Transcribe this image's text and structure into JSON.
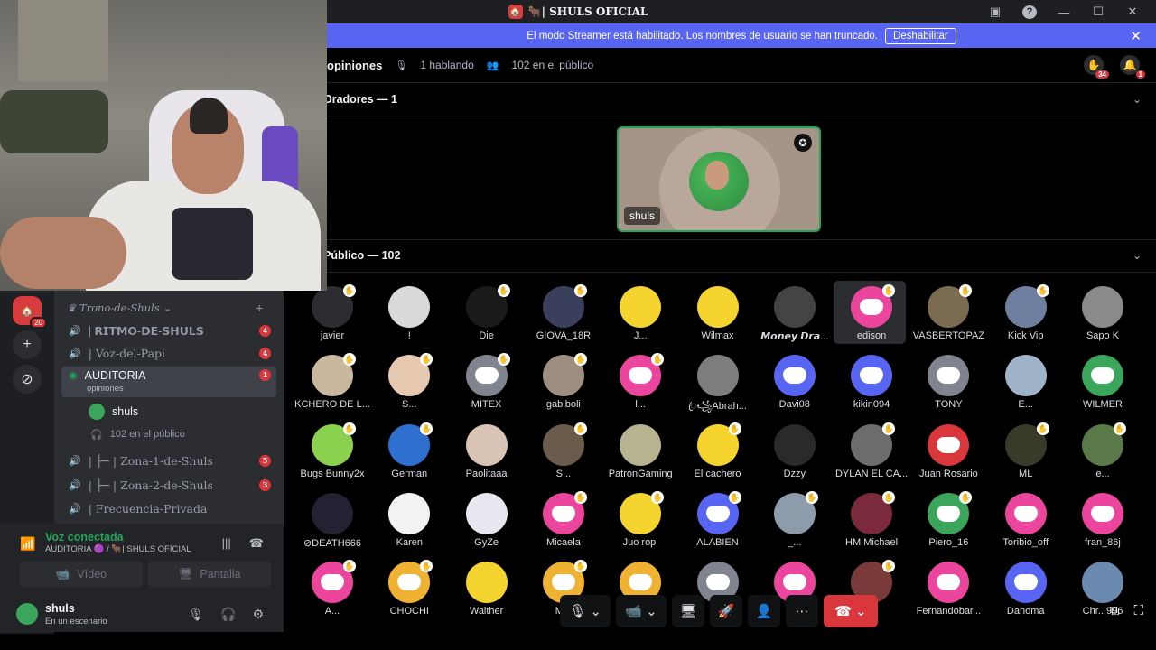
{
  "window": {
    "title": "🐂| SHULS OFICIAL"
  },
  "banner": {
    "text": "El modo Streamer está habilitado. Los nombres de usuario se han truncado.",
    "button": "Deshabilitar"
  },
  "stage_header": {
    "channel": "opiniones",
    "speaking": "1 hablando",
    "audience": "102 en el público",
    "hand_count": "34",
    "notif_count": "1"
  },
  "sections": {
    "speakers": "Oradores — 1",
    "audience": "Público — 102"
  },
  "speaker": {
    "name": "shuls"
  },
  "audience": [
    {
      "name": "javier",
      "color": "#2b2d31",
      "hand": true
    },
    {
      "name": "!",
      "color": "#d9d9d9",
      "hand": false
    },
    {
      "name": "Die",
      "color": "#1a1a1a",
      "hand": true
    },
    {
      "name": "GIOVA_18R",
      "color": "#3a3f5c",
      "hand": true
    },
    {
      "name": "J...",
      "color": "#f6d42f",
      "hand": false
    },
    {
      "name": "Wilmax",
      "color": "#f6d42f",
      "hand": false
    },
    {
      "name": "𝙈𝙤𝙣𝙚𝙮 𝘿𝙧𝙖...",
      "color": "#444444",
      "hand": false
    },
    {
      "name": "edison",
      "color": "#eb459e",
      "hand": true,
      "discord": true,
      "highlight": true
    },
    {
      "name": "VASBERTOPAZ",
      "color": "#7a6a50",
      "hand": true
    },
    {
      "name": "Kick Vip",
      "color": "#6f7f9f",
      "hand": true
    },
    {
      "name": "Sapo K",
      "color": "#8a8a8a",
      "hand": false
    },
    {
      "name": "KCHERO DE L...",
      "color": "#c9b7a0",
      "hand": true
    },
    {
      "name": "S...",
      "color": "#e7c8b0",
      "hand": true
    },
    {
      "name": "MITEX",
      "color": "#80848e",
      "hand": true,
      "discord": true
    },
    {
      "name": "gabiboli",
      "color": "#9c8f80",
      "hand": true
    },
    {
      "name": "l...",
      "color": "#eb459e",
      "hand": true,
      "discord": true
    },
    {
      "name": "ꦿ꧁Abrah...",
      "color": "#7d7d7d",
      "hand": false
    },
    {
      "name": "Davi08",
      "color": "#5865f2",
      "hand": false,
      "discord": true
    },
    {
      "name": "kikin094",
      "color": "#5865f2",
      "hand": false,
      "discord": true
    },
    {
      "name": "TONY",
      "color": "#80848e",
      "hand": false,
      "discord": true
    },
    {
      "name": "E...",
      "color": "#9fb3c8",
      "hand": false
    },
    {
      "name": "WILMER",
      "color": "#3ba55c",
      "hand": false,
      "discord": true
    },
    {
      "name": "Bugs Bunny2x",
      "color": "#8ad14f",
      "hand": true
    },
    {
      "name": "German",
      "color": "#2e6fd0",
      "hand": true
    },
    {
      "name": "Paolitaaa",
      "color": "#d8c3b4",
      "hand": false
    },
    {
      "name": "S...",
      "color": "#6b5b4b",
      "hand": true
    },
    {
      "name": "PatronGaming",
      "color": "#b7b28f",
      "hand": false
    },
    {
      "name": "El cachero",
      "color": "#f6d42f",
      "hand": true
    },
    {
      "name": "Dzzy",
      "color": "#2a2a2a",
      "hand": false
    },
    {
      "name": "DYLAN EL CA...",
      "color": "#6d6d6d",
      "hand": true
    },
    {
      "name": "Juan Rosario",
      "color": "#da373c",
      "hand": false,
      "discord": true
    },
    {
      "name": "ML",
      "color": "#3a3a2a",
      "hand": true
    },
    {
      "name": "e...",
      "color": "#5b7a4a",
      "hand": true
    },
    {
      "name": "⊘DEATH666",
      "color": "#222233",
      "hand": false
    },
    {
      "name": "Karen",
      "color": "#f2f2f2",
      "hand": false
    },
    {
      "name": "GyZe",
      "color": "#e7e7ef",
      "hand": false
    },
    {
      "name": "Micaela",
      "color": "#eb459e",
      "hand": true,
      "discord": true
    },
    {
      "name": "Juo ropl",
      "color": "#f6d42f",
      "hand": true
    },
    {
      "name": "ALABIEN",
      "color": "#5865f2",
      "hand": true,
      "discord": true
    },
    {
      "name": "_...",
      "color": "#8d9caa",
      "hand": true
    },
    {
      "name": "HM Michael",
      "color": "#7a2a3a",
      "hand": true
    },
    {
      "name": "Piero_16",
      "color": "#3ba55c",
      "hand": true,
      "discord": true
    },
    {
      "name": "Toribio_off",
      "color": "#eb459e",
      "hand": false,
      "discord": true
    },
    {
      "name": "fran_86j",
      "color": "#eb459e",
      "hand": false,
      "discord": true
    },
    {
      "name": "A...",
      "color": "#eb459e",
      "hand": true,
      "discord": true
    },
    {
      "name": "CHOCHI",
      "color": "#f0b232",
      "hand": true,
      "discord": true
    },
    {
      "name": "Walther",
      "color": "#f6d42f",
      "hand": false
    },
    {
      "name": "M...",
      "color": "#f0b232",
      "hand": true,
      "discord": true
    },
    {
      "name": "",
      "color": "#f0b232",
      "hand": false,
      "discord": true
    },
    {
      "name": "",
      "color": "#80848e",
      "hand": false,
      "discord": true
    },
    {
      "name": "",
      "color": "#eb459e",
      "hand": false,
      "discord": true
    },
    {
      "name": "",
      "color": "#7a3a3a",
      "hand": true
    },
    {
      "name": "Fernandobar...",
      "color": "#eb459e",
      "hand": false,
      "discord": true
    },
    {
      "name": "Danoma",
      "color": "#5865f2",
      "hand": false,
      "discord": true
    },
    {
      "name": "Chr...996",
      "color": "#6a8ab0",
      "hand": false
    }
  ],
  "sidebar": {
    "server_badge": "20",
    "category": "Trono-de-Shuls",
    "channels": [
      {
        "name": "| 𝗥𝗜𝗧𝗠𝗢-𝗗𝗘-𝗦𝗛𝗨𝗟𝗦",
        "badge": "4"
      },
      {
        "name": "| Voz-del-Papi",
        "badge": "4"
      },
      {
        "name": "AUDITORIA",
        "sub": "opiniones",
        "badge": "1",
        "active": true
      },
      {
        "name": "shuls"
      },
      {
        "name": "102 en el público"
      },
      {
        "name": "| ├─ | Zona-1-de-Shuls",
        "badge": "5"
      },
      {
        "name": "| ├─ | Zona-2-de-Shuls",
        "badge": "3"
      },
      {
        "name": "| Frecuencia-Privada"
      }
    ]
  },
  "voice": {
    "status": "Voz conectada",
    "location": "AUDITORIA 🟣 / 🐂| SHULS OFICIAL",
    "video": "Vídeo",
    "screen": "Pantalla"
  },
  "user": {
    "name": "shuls",
    "status": "En un escenario"
  }
}
